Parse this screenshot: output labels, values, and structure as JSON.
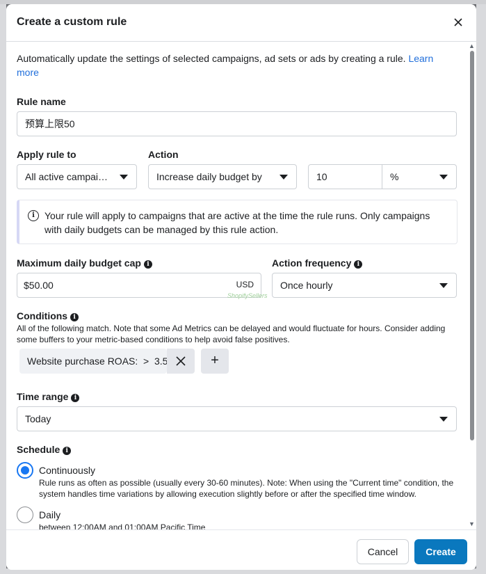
{
  "modal": {
    "title": "Create a custom rule",
    "intro": "Automatically update the settings of selected campaigns, ad sets or ads by creating a rule.",
    "learn_more": "Learn more"
  },
  "rule_name": {
    "label": "Rule name",
    "value": "预算上限50"
  },
  "apply_rule_to": {
    "label": "Apply rule to",
    "value": "All active campai…"
  },
  "action": {
    "label": "Action",
    "value": "Increase daily budget by",
    "amount": "10",
    "unit": "%"
  },
  "notice": {
    "text": "Your rule will apply to campaigns that are active at the time the rule runs. Only campaigns with daily budgets can be managed by this rule action."
  },
  "budget_cap": {
    "label": "Maximum daily budget cap",
    "value": "$50.00",
    "currency": "USD"
  },
  "action_frequency": {
    "label": "Action frequency",
    "value": "Once hourly"
  },
  "conditions": {
    "label": "Conditions",
    "description": "All of the following match. Note that some Ad Metrics can be delayed and would fluctuate for hours. Consider adding some buffers to your metric-based conditions to help avoid false positives.",
    "items": [
      {
        "text": "Website purchase ROAS:  >  3.5"
      }
    ],
    "add_label": "+"
  },
  "time_range": {
    "label": "Time range",
    "value": "Today"
  },
  "schedule": {
    "label": "Schedule",
    "options": [
      {
        "label": "Continuously",
        "description": "Rule runs as often as possible (usually every 30-60 minutes). Note: When using the \"Current time\" condition, the system handles time variations by allowing execution slightly before or after the specified time window.",
        "selected": true
      },
      {
        "label": "Daily",
        "description": "between 12:00AM and 01:00AM Pacific Time",
        "selected": false
      }
    ]
  },
  "watermark": "ShopifySellers",
  "footer": {
    "cancel_label": "Cancel",
    "create_label": "Create"
  },
  "colors": {
    "primary_button": "#0a78be",
    "link": "#216fdb",
    "radio_selected": "#1877f2"
  }
}
